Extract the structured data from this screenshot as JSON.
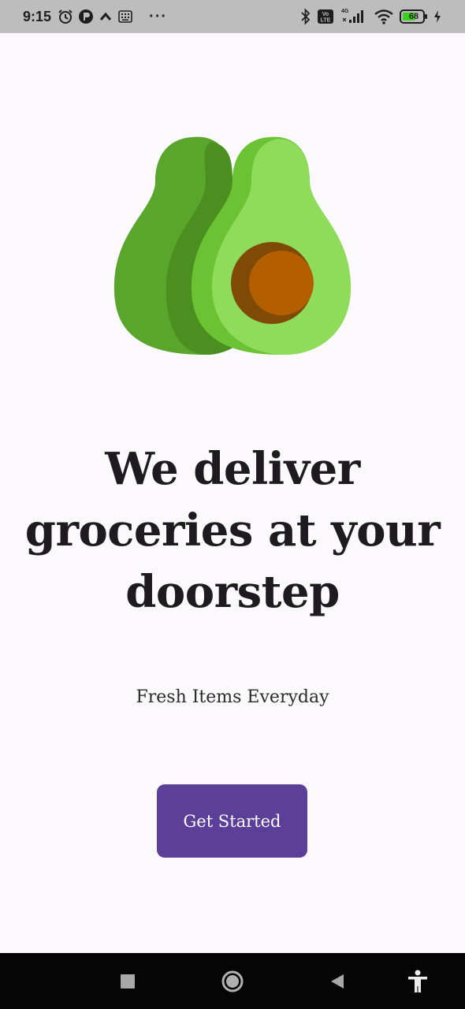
{
  "status_bar": {
    "time": "9:15",
    "network_badge": "4G",
    "volte_label": "Vo LTE",
    "battery_level": "68",
    "more_glyph": "···",
    "icons": [
      "alarm-icon",
      "app-notification-icon",
      "chevron-up-icon",
      "keyboard-icon",
      "bluetooth-icon",
      "volte-icon",
      "signal-icon",
      "wifi-icon",
      "battery-icon",
      "charging-icon"
    ]
  },
  "hero": {
    "icon": "avocado-icon",
    "colors": {
      "dark_green": "#5aa52c",
      "mid_green": "#6bc232",
      "light_green": "#8fdb5a",
      "pit": "#b35f00"
    }
  },
  "headline": "We deliver groceries at your doorstep",
  "subtitle": "Fresh Items Everyday",
  "cta": {
    "label": "Get Started",
    "color": "#5b3f99"
  },
  "nav_bar": {
    "icons": [
      "recents-square-icon",
      "home-circle-icon",
      "back-triangle-icon",
      "accessibility-icon"
    ]
  }
}
